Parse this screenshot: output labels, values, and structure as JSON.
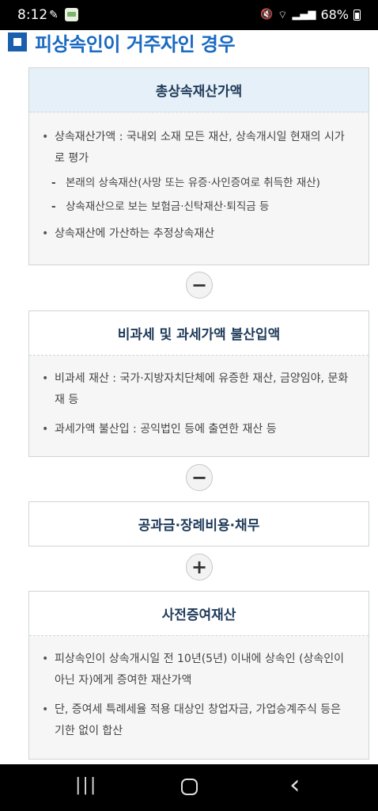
{
  "status_bar": {
    "time": "8:12",
    "battery": "68%",
    "icons": [
      "link-icon",
      "app-notification-icon",
      "mute-icon",
      "wifi-icon",
      "signal-icon",
      "battery-icon"
    ]
  },
  "heading": {
    "text": "피상속인이 거주자인 경우"
  },
  "boxes": [
    {
      "title": "총상속재산가액",
      "items": [
        {
          "text": "상속재산가액 : 국내외 소재 모든 재산, 상속개시일 현재의 시가로 평가",
          "subitems": [
            "본래의 상속재산(사망 또는 유증·사인증여로 취득한 재산)",
            "상속재산으로 보는 보험금·신탁재산·퇴직금 등"
          ]
        },
        {
          "text": "상속재산에 가산하는 추정상속재산"
        }
      ]
    },
    {
      "title": "비과세 및 과세가액 불산입액",
      "items": [
        {
          "text": "비과세 재산 : 국가·지방자치단체에 유증한 재산, 금양임야, 문화재 등"
        },
        {
          "text": "과세가액 불산입 : 공익법인 등에 출연한 재산 등"
        }
      ]
    },
    {
      "title": "공과금·장례비용·채무"
    },
    {
      "title": "사전증여재산",
      "items": [
        {
          "text": "피상속인이 상속개시일 전 10년(5년) 이내에 상속인 (상속인이 아닌 자)에게 증여한 재산가액"
        },
        {
          "text": "단, 증여세 특례세율 적용 대상인 창업자금, 가업승계주식 등은 기한 없이 합산"
        }
      ]
    }
  ],
  "operators": [
    "−",
    "−",
    "+"
  ],
  "nav_bar": {
    "recents": "|||",
    "back": "‹"
  }
}
